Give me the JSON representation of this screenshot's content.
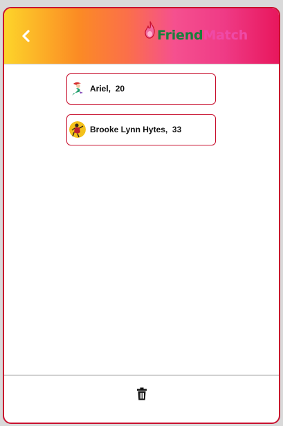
{
  "app": {
    "logo_part1": "Friend",
    "logo_part2": "Match",
    "brand_green": "#1a7f3c",
    "brand_pink": "#ef4aa7",
    "accent_border": "#c8102e"
  },
  "header": {
    "back_icon": "chevron-left-icon"
  },
  "matches": [
    {
      "name": "Ariel,",
      "age": "20",
      "avatar_icon": "mermaid-avatar-icon"
    },
    {
      "name": "Brooke Lynn Hytes,",
      "age": "33",
      "avatar_icon": "dancer-avatar-icon"
    }
  ],
  "footer": {
    "delete_icon": "trash-icon"
  }
}
